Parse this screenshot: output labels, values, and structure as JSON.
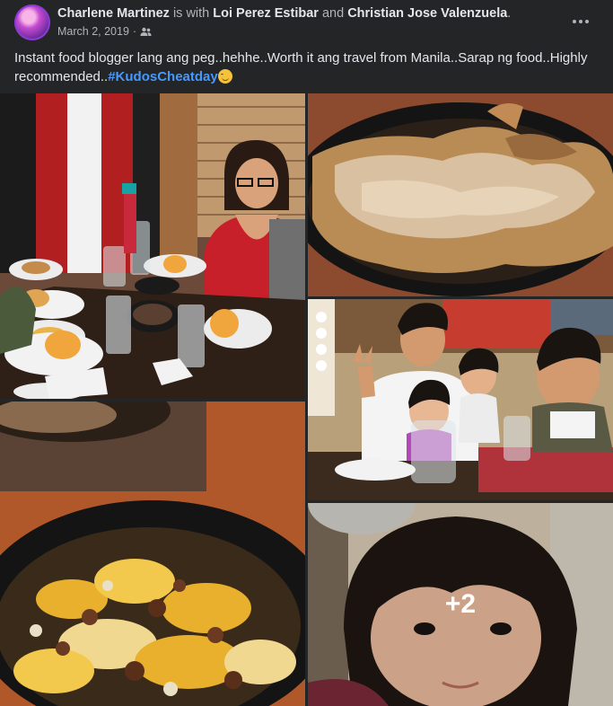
{
  "post": {
    "author": "Charlene Martinez",
    "with_text": "is with",
    "tagged_1": "Loi Perez Estibar",
    "and_text": "and",
    "tagged_2": "Christian Jose Valenzuela",
    "period": ".",
    "date": "March 2, 2019",
    "separator": "·",
    "privacy_icon": "friends-icon",
    "caption_text": "Instant food blogger lang ang peg..hehhe..Worth it ang travel from Manila..Sarap ng food..Highly recommended..",
    "hashtag": "#KudosCheatday",
    "emoji": "smiling-face-emoji",
    "more_photos_count": "+2"
  },
  "colors": {
    "background": "#242526",
    "text_primary": "#e4e6eb",
    "text_secondary": "#b0b3b8",
    "link": "#4599ff"
  }
}
